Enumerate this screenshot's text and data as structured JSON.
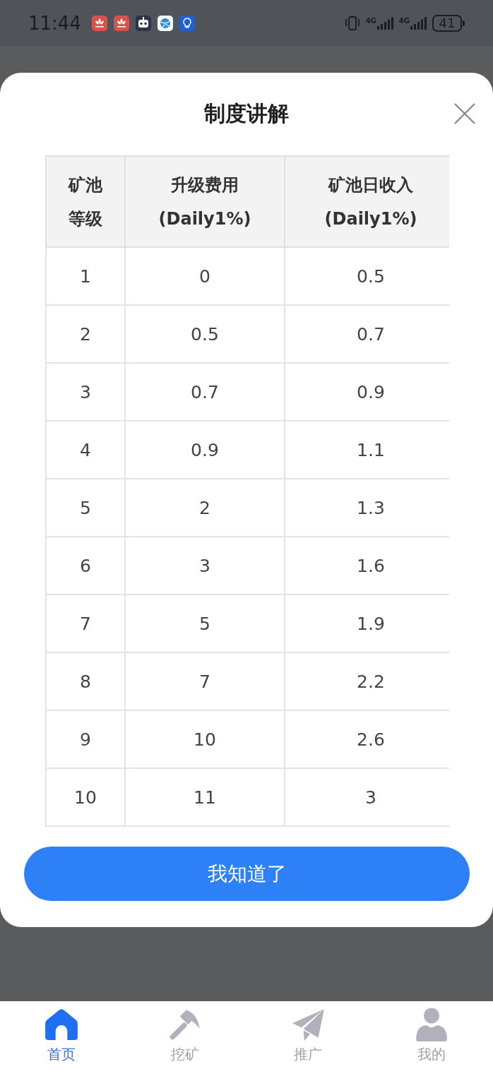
{
  "status_bar": {
    "time": "11:44",
    "networks": [
      {
        "type": "4G"
      },
      {
        "type": "4G"
      }
    ],
    "battery": "41"
  },
  "dialog": {
    "title": "制度讲解",
    "table": {
      "columns": [
        "矿池等级",
        "升级费用 (Daily1%)",
        "矿池日收入 (Daily1%)"
      ],
      "rows": [
        [
          "1",
          "0",
          "0.5"
        ],
        [
          "2",
          "0.5",
          "0.7"
        ],
        [
          "3",
          "0.7",
          "0.9"
        ],
        [
          "4",
          "0.9",
          "1.1"
        ],
        [
          "5",
          "2",
          "1.3"
        ],
        [
          "6",
          "3",
          "1.6"
        ],
        [
          "7",
          "5",
          "1.9"
        ],
        [
          "8",
          "7",
          "2.2"
        ],
        [
          "9",
          "10",
          "2.6"
        ],
        [
          "10",
          "11",
          "3"
        ]
      ]
    },
    "confirm_button": "我知道了"
  },
  "nav_tabs": [
    {
      "label": "首页",
      "selected": true
    },
    {
      "label": "挖矿",
      "selected": false
    },
    {
      "label": "推广",
      "selected": false
    },
    {
      "label": "我的",
      "selected": false
    }
  ]
}
